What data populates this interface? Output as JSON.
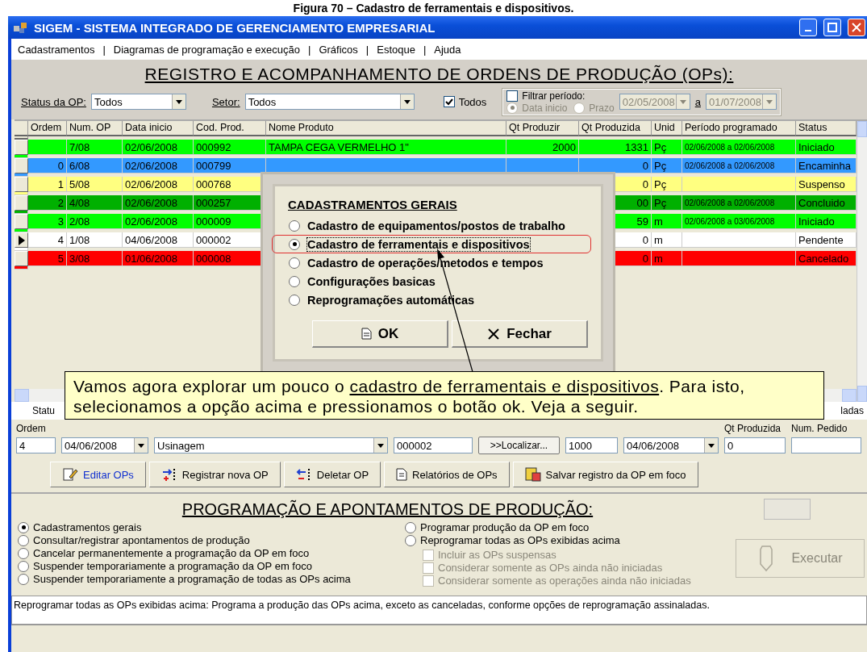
{
  "caption": "Figura 70 – Cadastro de ferramentais e dispositivos.",
  "window": {
    "title": "SIGEM - SISTEMA INTEGRADO DE GERENCIAMENTO EMPRESARIAL"
  },
  "menu": [
    {
      "label": "Cadastramentos"
    },
    {
      "label": "Diagramas de programação e execução"
    },
    {
      "label": "Gráficos"
    },
    {
      "label": "Estoque"
    },
    {
      "label": "Ajuda"
    }
  ],
  "menu_separator": "|",
  "registro": {
    "title": "REGISTRO E ACOMPANHAMENTO DE ORDENS DE PRODUÇÃO (OPs):",
    "filters": {
      "status_label": "Status da OP:",
      "status_value": "Todos",
      "setor_label": "Setor:",
      "setor_value": "Todos",
      "todos": {
        "label": "Todos",
        "checked": true
      },
      "periodo": {
        "label": "Filtrar período:",
        "checked": false
      },
      "period_options": [
        {
          "label": "Data inicio",
          "selected": true
        },
        {
          "label": "Prazo",
          "selected": false
        }
      ],
      "date_from": "02/05/2008",
      "date_sep": "a",
      "date_to": "01/07/2008"
    }
  },
  "table": {
    "columns": [
      "Ordem",
      "Num. OP",
      "Data inicio",
      "Cod. Prod.",
      "Nome Produto",
      "Qt Produzir",
      "Qt Produzida",
      "Unid",
      "Período programado",
      "Status"
    ],
    "rows": [
      {
        "ordem": "",
        "num_op": "7/08",
        "data_inicio": "02/06/2008",
        "cod_prod": "000992",
        "nome_produto": "TAMPA CEGA VERMELHO 1\"",
        "qt_produzir": "2000",
        "qt_produzida": "1331",
        "unid": "Pç",
        "periodo": "02/06/2008 a 02/06/2008",
        "status": "Iniciado",
        "color": "#00ff00",
        "selected": false
      },
      {
        "ordem": "0",
        "num_op": "6/08",
        "data_inicio": "02/06/2008",
        "cod_prod": "000799",
        "qt_produzida": "0",
        "unid": "Pç",
        "periodo": "02/06/2008 a 02/06/2008",
        "status": "Encaminha",
        "color": "#3399ff",
        "selected": false
      },
      {
        "ordem": "1",
        "num_op": "5/08",
        "data_inicio": "02/06/2008",
        "cod_prod": "000768",
        "qt_produzida": "0",
        "unid": "Pç",
        "status": "Suspenso",
        "color": "#ffff80",
        "selected": false
      },
      {
        "ordem": "2",
        "num_op": "4/08",
        "data_inicio": "02/06/2008",
        "cod_prod": "000257",
        "qt_produzida": "00",
        "unid": "Pç",
        "periodo": "02/06/2008 a 02/06/2008",
        "status": "Concluido",
        "color": "#00b000",
        "selected": false
      },
      {
        "ordem": "3",
        "num_op": "2/08",
        "data_inicio": "02/06/2008",
        "cod_prod": "000009",
        "qt_produzida": "59",
        "unid": "m",
        "periodo": "02/06/2008 a 03/06/2008",
        "status": "Iniciado",
        "color": "#00ff00",
        "selected": false
      },
      {
        "ordem": "4",
        "num_op": "1/08",
        "data_inicio": "04/06/2008",
        "cod_prod": "000002",
        "qt_produzida": "0",
        "unid": "m",
        "status": "Pendente",
        "color": "#ffffff",
        "selected": true
      },
      {
        "ordem": "5",
        "num_op": "3/08",
        "data_inicio": "01/06/2008",
        "cod_prod": "000008",
        "qt_produzida": "0",
        "unid": "m",
        "status": "Cancelado",
        "color": "#ff0000",
        "selected": false
      }
    ]
  },
  "legend": {
    "label": "Statu",
    "tail": "ladas"
  },
  "form": {
    "fields": [
      {
        "kind": "text",
        "label": "Ordem",
        "value": "4"
      },
      {
        "kind": "combo",
        "value": "04/06/2008"
      },
      {
        "kind": "combo",
        "value": "Usinagem"
      },
      {
        "kind": "text",
        "value": "000002"
      },
      {
        "kind": "button",
        "value": ">>Localizar..."
      },
      {
        "kind": "text",
        "value": "1000"
      },
      {
        "kind": "combo",
        "value": "04/06/2008"
      },
      {
        "kind": "text",
        "label": "Qt Produzida",
        "value": "0"
      },
      {
        "kind": "text",
        "label": "Num. Pedido"
      }
    ]
  },
  "actions": [
    {
      "label": "Editar OPs",
      "kind": "edit"
    },
    {
      "label": "Registrar nova OP",
      "kind": "add"
    },
    {
      "label": "Deletar OP",
      "kind": "delete"
    },
    {
      "label": "Relatórios de OPs",
      "kind": "report"
    },
    {
      "label": "Salvar registro da OP em foco",
      "kind": "save"
    }
  ],
  "programacao": {
    "title": "PROGRAMAÇÃO E APONTAMENTOS DE PRODUÇÃO:",
    "options_left": [
      {
        "label": "Cadastramentos gerais",
        "selected": true
      },
      {
        "label": "Consultar/registrar apontamentos de produção",
        "selected": false
      },
      {
        "label": "Cancelar permanentemente a programação da OP em foco",
        "selected": false
      },
      {
        "label": "Suspender temporariamente a programação da OP em foco",
        "selected": false
      },
      {
        "label": "Suspender temporariamente a programação de todas as OPs acima",
        "selected": false
      }
    ],
    "options_right": [
      {
        "label": "Programar produção da OP em foco",
        "selected": false
      },
      {
        "label": "Reprogramar todas as OPs exibidas acima",
        "selected": false
      }
    ],
    "checks": [
      {
        "label": "Incluir as OPs suspensas",
        "checked": false,
        "disabled": true
      },
      {
        "label": "Considerar somente as OPs ainda não iniciadas",
        "checked": false,
        "disabled": true
      },
      {
        "label": "Considerar somente as operações ainda não iniciadas",
        "checked": false,
        "disabled": true
      }
    ],
    "execute": {
      "label": "Executar",
      "disabled": true
    },
    "description": "Reprogramar todas as OPs exibidas acima: Programa a produção das OPs acima, exceto as canceladas, conforme opções de reprogramação assinaladas."
  },
  "dialog": {
    "title": "CADASTRAMENTOS GERAIS",
    "options": [
      {
        "label": "Cadastro de equipamentos/postos de trabalho",
        "selected": false
      },
      {
        "label": "Cadastro de ferramentais e dispositivos",
        "selected": true
      },
      {
        "label": "Cadastro de operações/metodos e tempos",
        "selected": false
      },
      {
        "label": "Configurações basicas",
        "selected": false
      },
      {
        "label": "Reprogramações automáticas",
        "selected": false
      }
    ],
    "ok": "OK",
    "close": "Fechar"
  },
  "tooltip": {
    "before": "Vamos agora explorar um pouco o ",
    "link": "cadastro de ferramentais e dispositivos",
    "after": ". Para isto, selecionamos a opção acima e pressionamos o botão ok. Veja a seguir."
  }
}
